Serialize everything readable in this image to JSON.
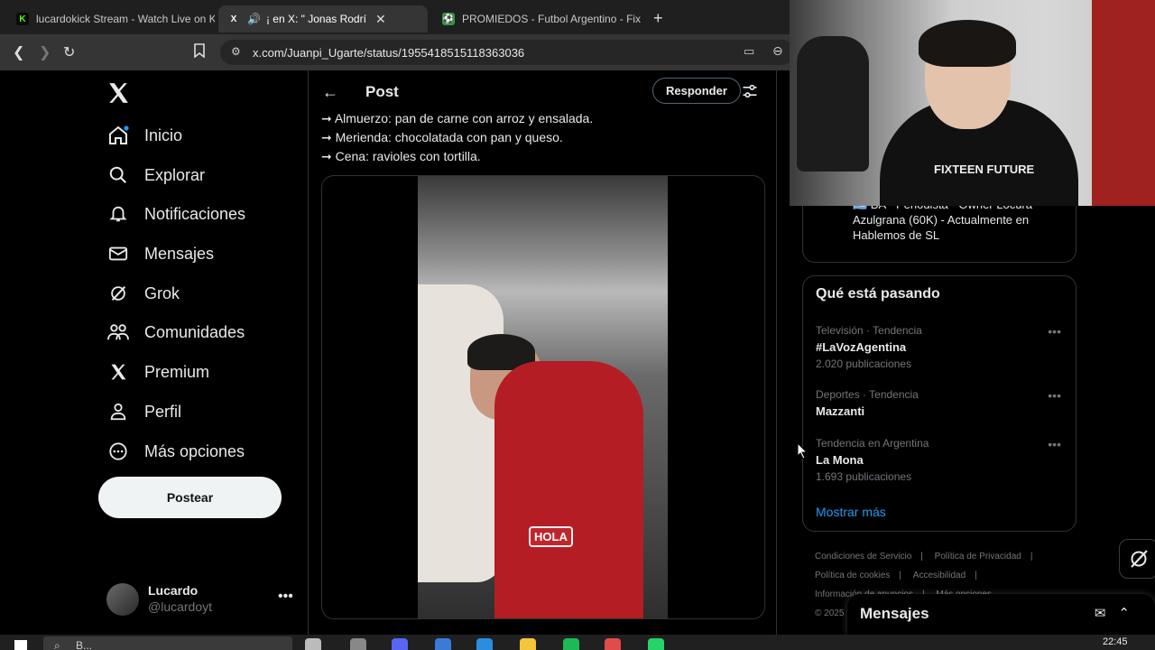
{
  "browser": {
    "tabs": [
      {
        "title": "lucardokick Stream - Watch Live on K",
        "favicon": "K",
        "color": "#53fc18",
        "active": false
      },
      {
        "title": "¡ en X: \"  Jonas Rodrí",
        "favicon": "X",
        "color": "#ffffff",
        "active": true
      },
      {
        "title": "PROMIEDOS - Futbol Argentino - Fix",
        "favicon": "⚽",
        "color": "#2e9c3a",
        "active": false
      }
    ],
    "url": "x.com/Juanpi_Ugarte/status/1955418515118363036"
  },
  "nav": {
    "items": [
      {
        "label": "Inicio",
        "icon": "home-icon"
      },
      {
        "label": "Explorar",
        "icon": "search-icon"
      },
      {
        "label": "Notificaciones",
        "icon": "bell-icon"
      },
      {
        "label": "Mensajes",
        "icon": "mail-icon"
      },
      {
        "label": "Grok",
        "icon": "grok-icon"
      },
      {
        "label": "Comunidades",
        "icon": "communities-icon"
      },
      {
        "label": "Premium",
        "icon": "x-premium-icon"
      },
      {
        "label": "Perfil",
        "icon": "person-icon"
      },
      {
        "label": "Más opciones",
        "icon": "more-circle-icon"
      }
    ],
    "post_button": "Postear",
    "profile": {
      "name": "Lucardo",
      "handle": "@lucardoyt"
    }
  },
  "post": {
    "header_title": "Post",
    "reply_button": "Responder",
    "lines": [
      "➞ Almuerzo: pan de carne con arroz y ensalada.",
      "➞ Merienda: chocolatada con pan y queso.",
      "➞ Cena: ravioles con tortilla."
    ],
    "video_caption": "HOLA"
  },
  "sidebar": {
    "bio": "🇦🇷 BA - Periodista - Owner Locura Azulgrana (60K) - Actualmente en Hablemos de SL",
    "trends_title": "Qué está pasando",
    "trends": [
      {
        "context": "Televisión · Tendencia",
        "name": "#LaVozAgentina",
        "count": "2.020 publicaciones"
      },
      {
        "context": "Deportes · Tendencia",
        "name": "Mazzanti",
        "count": ""
      },
      {
        "context": "Tendencia en Argentina",
        "name": "La Mona",
        "count": "1.693 publicaciones"
      }
    ],
    "show_more": "Mostrar más",
    "footer_links": [
      "Condiciones de Servicio",
      "Política de Privacidad",
      "Política de cookies",
      "Accesibilidad",
      "Información de anuncios",
      "Más opciones"
    ],
    "copyright": "© 2025"
  },
  "messages_drawer": {
    "title": "Mensajes"
  },
  "webcam": {
    "shirt_text": "FIXTEEN FUTURE"
  },
  "taskbar": {
    "search_placeholder": "B...",
    "time": "22:45"
  }
}
